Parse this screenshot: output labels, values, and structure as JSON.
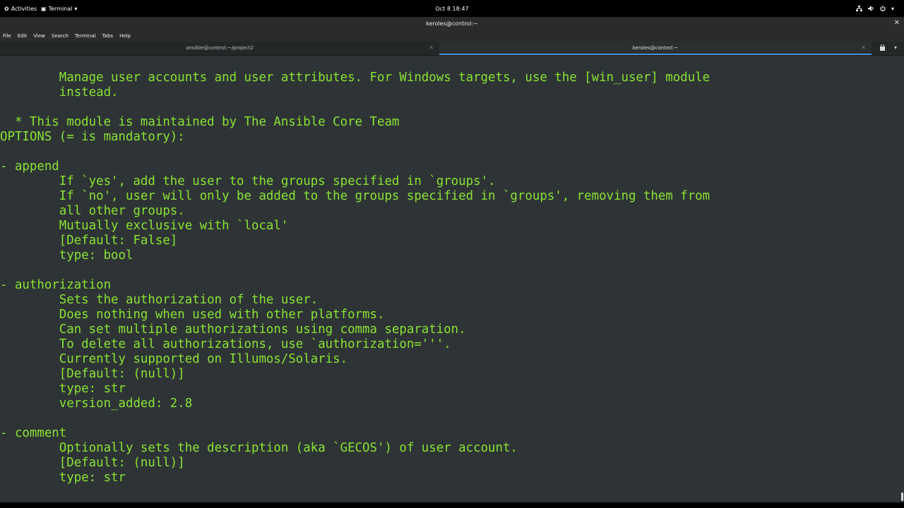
{
  "topbar": {
    "activities": "Activities",
    "app_menu": "Terminal",
    "clock": "Oct 8  18:47",
    "icons": [
      "network-icon",
      "volume-icon",
      "power-icon",
      "chevron-down-icon"
    ]
  },
  "window": {
    "title": "keroles@control:~",
    "menu": [
      "File",
      "Edit",
      "View",
      "Search",
      "Terminal",
      "Tabs",
      "Help"
    ],
    "tabs": [
      {
        "label": "ansible@control:~/project2",
        "active": false
      },
      {
        "label": "keroles@control:~",
        "active": true
      }
    ]
  },
  "terminal": {
    "text_color": "#8ae234",
    "background": "#2e3436",
    "lines": [
      "        Manage user accounts and user attributes. For Windows targets, use the [win_user] module",
      "        instead.",
      "",
      "  * This module is maintained by The Ansible Core Team",
      "OPTIONS (= is mandatory):",
      "",
      "- append",
      "        If `yes', add the user to the groups specified in `groups'.",
      "        If `no', user will only be added to the groups specified in `groups', removing them from",
      "        all other groups.",
      "        Mutually exclusive with `local'",
      "        [Default: False]",
      "        type: bool",
      "",
      "- authorization",
      "        Sets the authorization of the user.",
      "        Does nothing when used with other platforms.",
      "        Can set multiple authorizations using comma separation.",
      "        To delete all authorizations, use `authorization='''.",
      "        Currently supported on Illumos/Solaris.",
      "        [Default: (null)]",
      "        type: str",
      "        version_added: 2.8",
      "",
      "- comment",
      "        Optionally sets the description (aka `GECOS') of user account.",
      "        [Default: (null)]",
      "        type: str"
    ]
  }
}
